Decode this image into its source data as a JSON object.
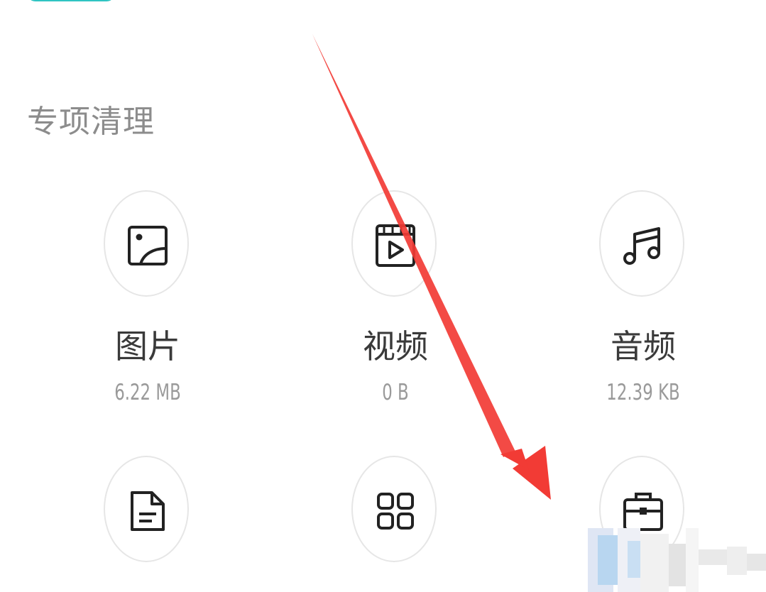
{
  "section": {
    "title": "专项清理"
  },
  "tiles": [
    {
      "name": "图片",
      "size": "6.22 MB",
      "icon": "image-icon"
    },
    {
      "name": "视频",
      "size": "0 B",
      "icon": "video-icon"
    },
    {
      "name": "音频",
      "size": "12.39 KB",
      "icon": "music-icon"
    },
    {
      "icon": "document-icon"
    },
    {
      "icon": "apps-grid-icon"
    },
    {
      "icon": "briefcase-icon"
    }
  ],
  "colors": {
    "accent": "#2fc4c2",
    "arrow": "#f23b35",
    "title_text": "#8c8c8c",
    "label_text": "#3a3a3a",
    "size_text": "#9a9a9a"
  }
}
